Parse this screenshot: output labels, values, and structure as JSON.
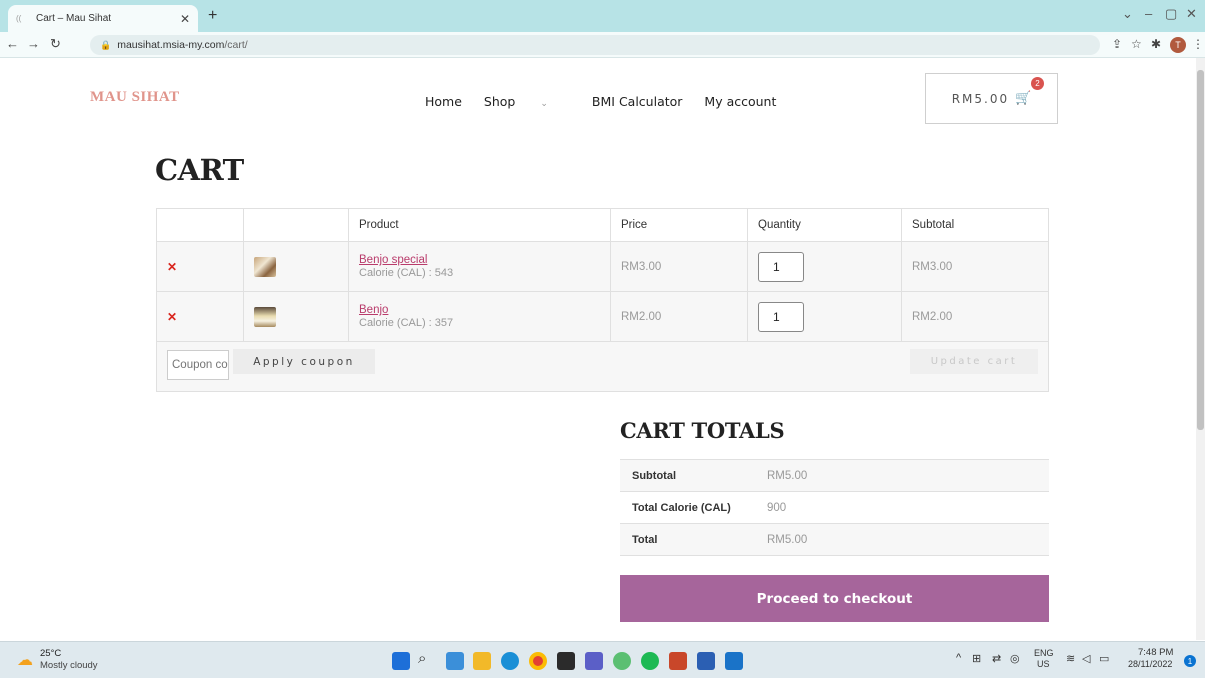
{
  "browser": {
    "tab_title": "Cart – Mau Sihat",
    "tab_favicon": "((",
    "url_domain": "mausihat.msia-my.com",
    "url_path": "/cart/",
    "profile_initial": "T"
  },
  "site": {
    "logo": "MAU SIHAT",
    "nav": [
      {
        "label": "Home"
      },
      {
        "label": "Shop"
      },
      {
        "label": "BMI Calculator"
      },
      {
        "label": "My account"
      }
    ],
    "cart_total": "RM5.00",
    "cart_count": "2"
  },
  "page": {
    "title": "CART"
  },
  "cart": {
    "headers": [
      "",
      "",
      "Product",
      "Price",
      "Quantity",
      "Subtotal"
    ],
    "items": [
      {
        "name": "Benjo special",
        "meta": "Calorie (CAL) : 543",
        "price": "RM3.00",
        "qty": "1",
        "subtotal": "RM3.00"
      },
      {
        "name": "Benjo",
        "meta": "Calorie (CAL) : 357",
        "price": "RM2.00",
        "qty": "1",
        "subtotal": "RM2.00"
      }
    ],
    "coupon_placeholder": "Coupon code",
    "apply_label": "Apply coupon",
    "update_label": "Update cart"
  },
  "totals": {
    "title": "CART TOTALS",
    "rows": [
      {
        "label": "Subtotal",
        "value": "RM5.00"
      },
      {
        "label": "Total Calorie (CAL)",
        "value": "900"
      },
      {
        "label": "Total",
        "value": "RM5.00"
      }
    ],
    "checkout_label": "Proceed to checkout"
  },
  "taskbar": {
    "temp": "25°C",
    "weather": "Mostly cloudy",
    "lang_top": "ENG",
    "lang_bottom": "US",
    "time": "7:48 PM",
    "date": "28/11/2022",
    "notifications": "1"
  },
  "colors": {
    "accent": "#a6659b",
    "logo": "#e0948b",
    "link": "#b93b6b",
    "remove": "#d9251d"
  }
}
